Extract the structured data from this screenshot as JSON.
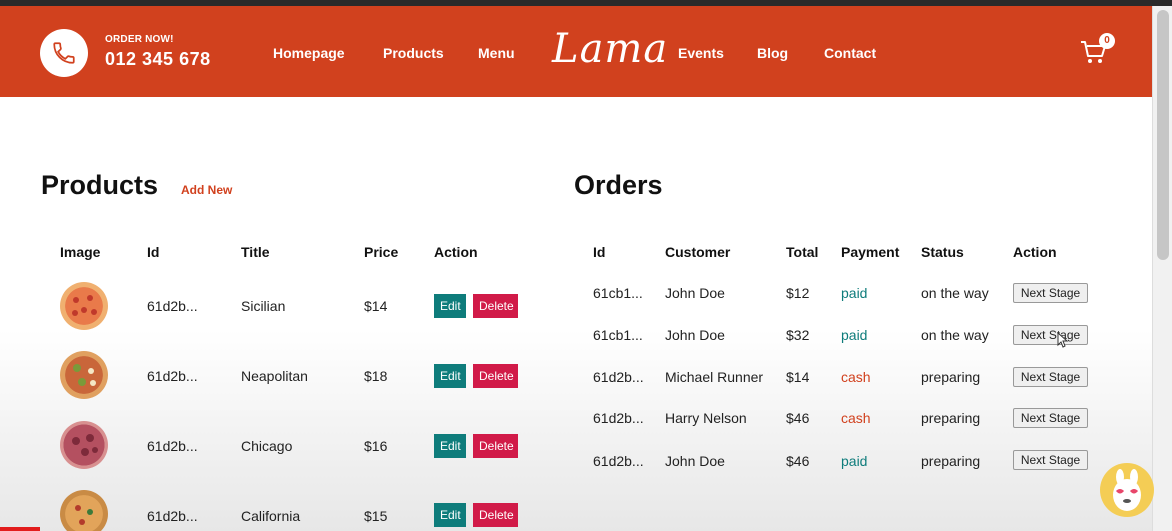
{
  "header": {
    "order_label": "ORDER NOW!",
    "phone": "012 345 678",
    "nav": [
      "Homepage",
      "Products",
      "Menu",
      "Events",
      "Blog",
      "Contact"
    ],
    "logo": "Lama",
    "cart_count": "0",
    "brand_color": "#d1411e"
  },
  "products": {
    "title": "Products",
    "add_new": "Add New",
    "columns": [
      "Image",
      "Id",
      "Title",
      "Price",
      "Action"
    ],
    "edit_label": "Edit",
    "delete_label": "Delete",
    "rows": [
      {
        "id": "61d2b...",
        "title": "Sicilian",
        "price": "$14"
      },
      {
        "id": "61d2b...",
        "title": "Neapolitan",
        "price": "$18"
      },
      {
        "id": "61d2b...",
        "title": "Chicago",
        "price": "$16"
      },
      {
        "id": "61d2b...",
        "title": "California",
        "price": "$15"
      }
    ]
  },
  "orders": {
    "title": "Orders",
    "columns": [
      "Id",
      "Customer",
      "Total",
      "Payment",
      "Status",
      "Action"
    ],
    "next_label": "Next Stage",
    "rows": [
      {
        "id": "61cb1...",
        "customer": "John Doe",
        "total": "$12",
        "payment": "paid",
        "status": "on the way"
      },
      {
        "id": "61cb1...",
        "customer": "John Doe",
        "total": "$32",
        "payment": "paid",
        "status": "on the way"
      },
      {
        "id": "61d2b...",
        "customer": "Michael Runner",
        "total": "$14",
        "payment": "cash",
        "status": "preparing"
      },
      {
        "id": "61d2b...",
        "customer": "Harry Nelson",
        "total": "$46",
        "payment": "cash",
        "status": "preparing"
      },
      {
        "id": "61d2b...",
        "customer": "John Doe",
        "total": "$46",
        "payment": "paid",
        "status": "preparing"
      }
    ]
  },
  "colors": {
    "paid": "#0e7c7b",
    "cash": "#d1411e",
    "edit": "#0e7c7b",
    "delete": "#d11a48"
  }
}
